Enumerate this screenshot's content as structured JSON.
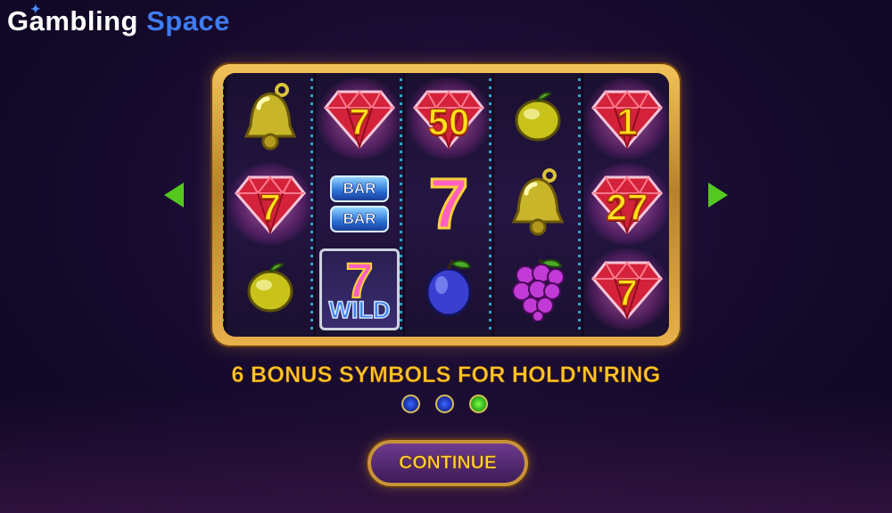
{
  "brand": {
    "word1": "Gambling",
    "word2": "Space"
  },
  "reels": [
    [
      {
        "type": "bell"
      },
      {
        "type": "gem",
        "value": "7"
      },
      {
        "type": "lemon"
      }
    ],
    [
      {
        "type": "gem",
        "value": "7"
      },
      {
        "type": "bar",
        "lines": [
          "BAR",
          "BAR"
        ]
      },
      {
        "type": "wild",
        "seven": "7",
        "label": "WILD"
      }
    ],
    [
      {
        "type": "gem",
        "value": "50"
      },
      {
        "type": "seven",
        "value": "7"
      },
      {
        "type": "plum"
      }
    ],
    [
      {
        "type": "lemon"
      },
      {
        "type": "bell"
      },
      {
        "type": "grapes"
      }
    ],
    [
      {
        "type": "gem",
        "value": "1"
      },
      {
        "type": "gem",
        "value": "27"
      },
      {
        "type": "gem",
        "value": "7"
      }
    ]
  ],
  "caption": "6 BONUS SYMBOLS FOR HOLD'N'RING",
  "pagination": {
    "total": 3,
    "active": 3
  },
  "continue_label": "CONTINUE",
  "icons": {
    "prev": "arrow-left-icon",
    "next": "arrow-right-icon"
  },
  "colors": {
    "accent": "#ffc72a",
    "arrow": "#55c81e",
    "frame": "#d9a545"
  }
}
